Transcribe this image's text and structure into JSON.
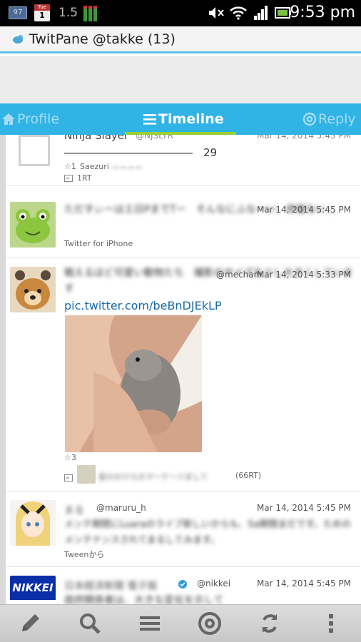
{
  "status_bar": {
    "badge": "97",
    "calendar_day_name": "Tue",
    "calendar_day": "1",
    "data_rate": "1.5",
    "time": "9:53 pm",
    "icons": [
      "notification-badge-icon",
      "calendar-icon",
      "signal-meter-icon",
      "mute-icon",
      "wifi-icon",
      "cell-signal-icon",
      "battery-icon"
    ]
  },
  "title_bar": {
    "title": "TwitPane @takke (13)"
  },
  "tabs": [
    {
      "label": "Profile",
      "icon": "home-icon"
    },
    {
      "label": "Timeline",
      "icon": "menu-icon"
    },
    {
      "label": "Reply",
      "icon": "at-icon"
    }
  ],
  "tweets": [
    {
      "name": "Ninja Slayer",
      "handle": "@NJSLYR",
      "date": "Mar 14, 2014 5:43 PM",
      "text": "――――――――――――　29",
      "favs": "☆1",
      "fav_user": "Saezuri",
      "rt": "1RT"
    },
    {
      "date": "Mar 14, 2014 5:45 PM",
      "source": "Twitter for iPhone"
    },
    {
      "handle": "@mecham",
      "date": "Mar 14, 2014 5:33 PM",
      "link": "pic.twitter.com/beBnDJEkLP",
      "favs": "☆3",
      "rt": "(66RT)"
    },
    {
      "handle": "@maruru_h",
      "date": "Mar 14, 2014 5:45 PM",
      "source": "Tweenから"
    },
    {
      "handle": "@nikkei",
      "date": "Mar 14, 2014 5:45 PM",
      "avatar_text": "NIKKEI"
    }
  ],
  "toolbar": {
    "icons": [
      "compose-icon",
      "search-icon",
      "list-icon",
      "mention-icon",
      "refresh-icon",
      "overflow-menu-icon"
    ]
  },
  "colors": {
    "accent": "#30b4e6",
    "tab_indicator": "#99d03a",
    "link": "#1a6aa6"
  }
}
